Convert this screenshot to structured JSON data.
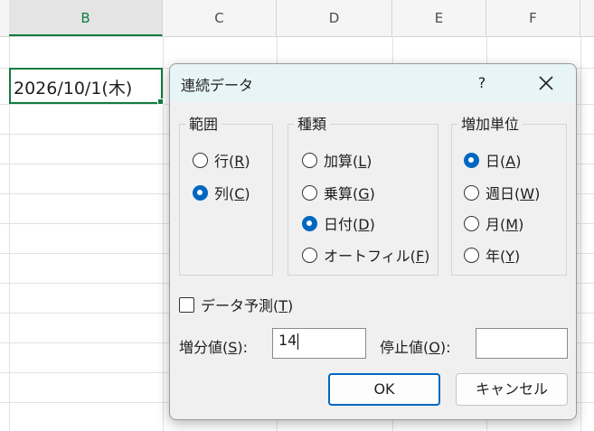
{
  "sheet": {
    "columns": [
      "B",
      "C",
      "D",
      "E",
      "F"
    ],
    "selected_column": "B",
    "active_cell_value": "2026/10/1(木)"
  },
  "dialog": {
    "title": "連続データ",
    "help": "?",
    "range": {
      "title": "範囲",
      "options": [
        {
          "label": "行(",
          "key": "R",
          "suffix": ")",
          "checked": false
        },
        {
          "label": "列(",
          "key": "C",
          "suffix": ")",
          "checked": true
        }
      ]
    },
    "type": {
      "title": "種類",
      "options": [
        {
          "label": "加算(",
          "key": "L",
          "suffix": ")",
          "checked": false
        },
        {
          "label": "乗算(",
          "key": "G",
          "suffix": ")",
          "checked": false
        },
        {
          "label": "日付(",
          "key": "D",
          "suffix": ")",
          "checked": true
        },
        {
          "label": "オートフィル(",
          "key": "F",
          "suffix": ")",
          "checked": false
        }
      ]
    },
    "unit": {
      "title": "増加単位",
      "options": [
        {
          "label": "日(",
          "key": "A",
          "suffix": ")",
          "checked": true
        },
        {
          "label": "週日(",
          "key": "W",
          "suffix": ")",
          "checked": false
        },
        {
          "label": "月(",
          "key": "M",
          "suffix": ")",
          "checked": false
        },
        {
          "label": "年(",
          "key": "Y",
          "suffix": ")",
          "checked": false
        }
      ]
    },
    "trend": {
      "label": "データ予測(",
      "key": "T",
      "suffix": ")",
      "checked": false
    },
    "step": {
      "label": "増分値(",
      "key": "S",
      "suffix": "):",
      "value": "14"
    },
    "stop": {
      "label": "停止値(",
      "key": "O",
      "suffix": "):",
      "value": ""
    },
    "ok_label": "OK",
    "cancel_label": "キャンセル"
  }
}
